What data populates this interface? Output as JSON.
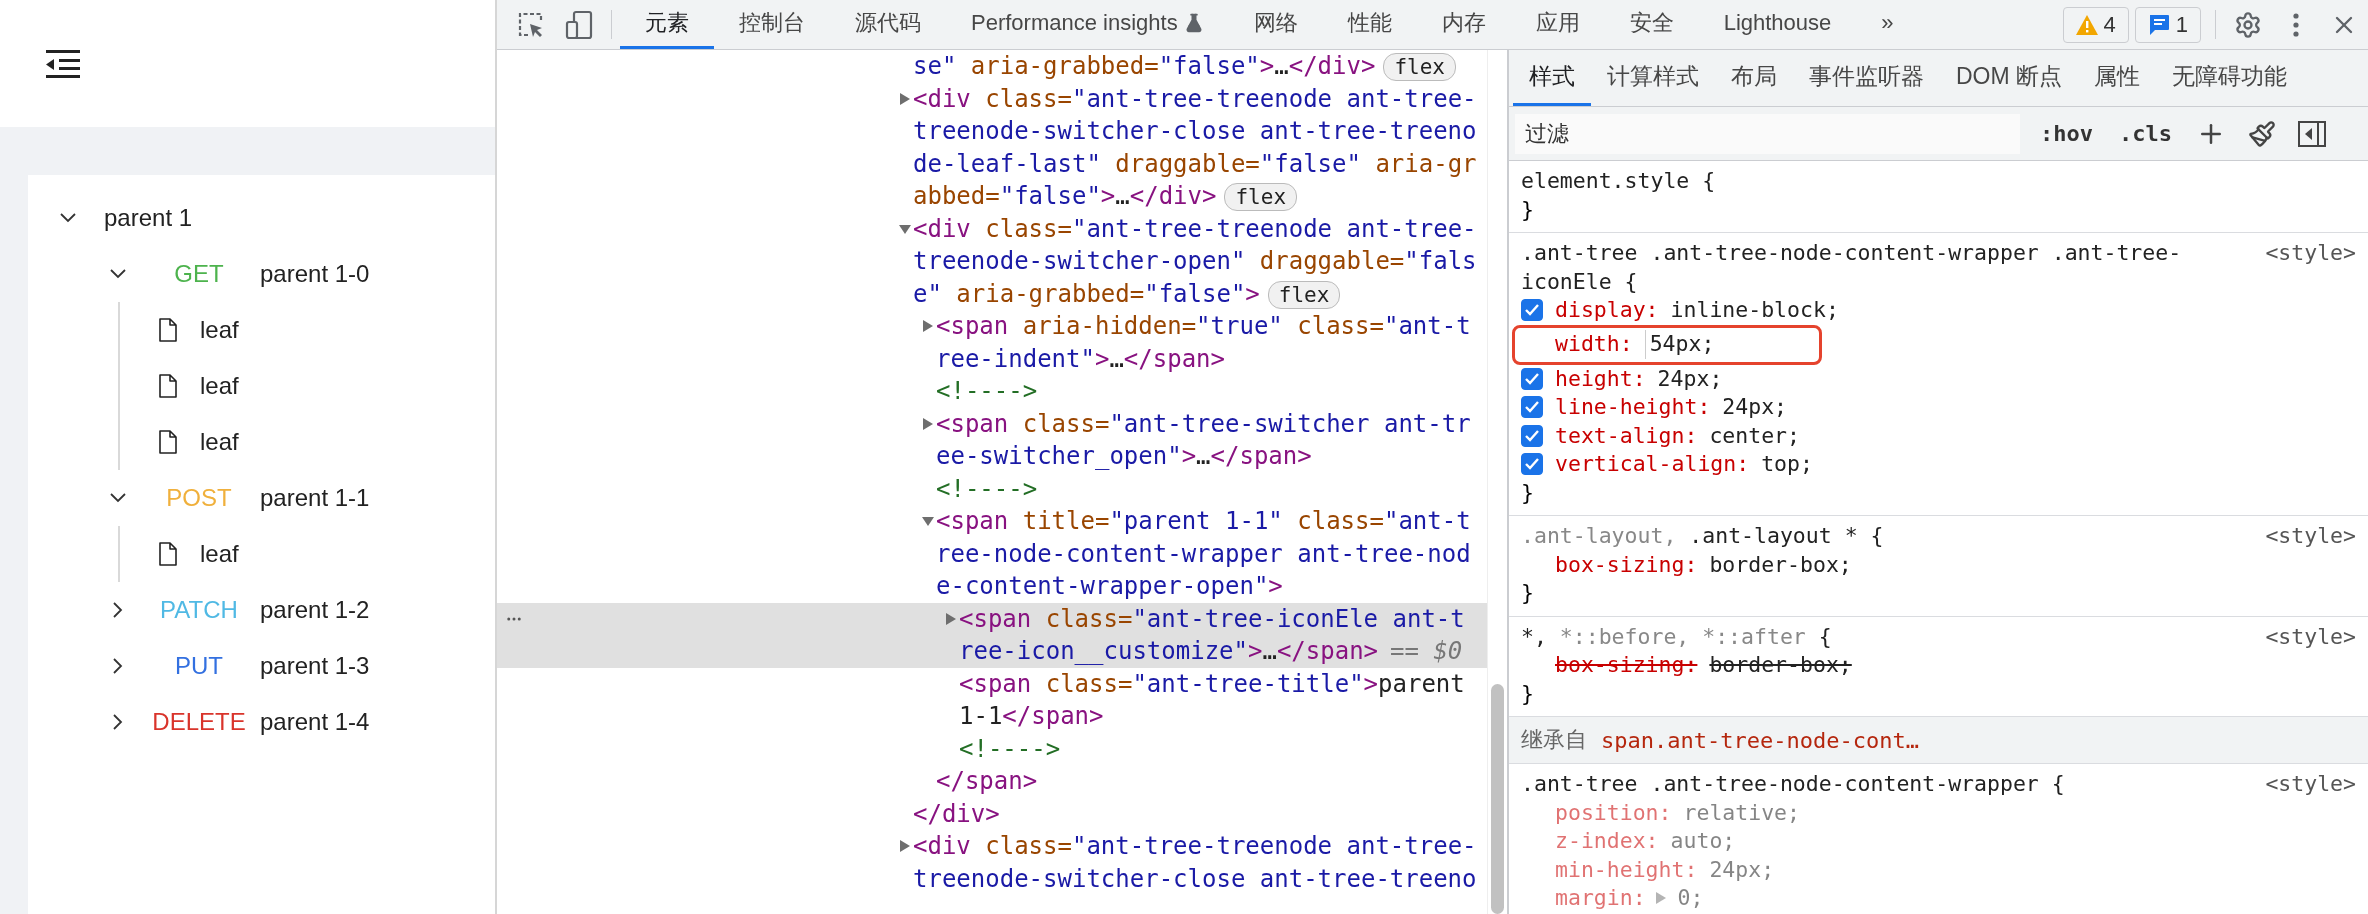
{
  "app": {
    "tree": [
      {
        "kind": "branch",
        "title": "parent 1",
        "expanded": true,
        "children": [
          {
            "kind": "branch",
            "method": "GET",
            "color": "#4db34d",
            "title": "parent 1-0",
            "expanded": true,
            "children": [
              {
                "kind": "leaf",
                "title": "leaf"
              },
              {
                "kind": "leaf",
                "title": "leaf"
              },
              {
                "kind": "leaf",
                "title": "leaf"
              }
            ]
          },
          {
            "kind": "branch",
            "method": "POST",
            "color": "#f0b03c",
            "title": "parent 1-1",
            "expanded": true,
            "children": [
              {
                "kind": "leaf",
                "title": "leaf"
              }
            ]
          },
          {
            "kind": "branch",
            "method": "PATCH",
            "color": "#50b9e4",
            "title": "parent 1-2",
            "expanded": false
          },
          {
            "kind": "branch",
            "method": "PUT",
            "color": "#3370e0",
            "title": "parent 1-3",
            "expanded": false
          },
          {
            "kind": "branch",
            "method": "DELETE",
            "color": "#d9342b",
            "title": "parent 1-4",
            "expanded": false
          }
        ]
      }
    ]
  },
  "devtools": {
    "toolbar": {
      "tabs": [
        {
          "label": "元素",
          "selected": true,
          "experimental": false
        },
        {
          "label": "控制台",
          "selected": false,
          "experimental": false
        },
        {
          "label": "源代码",
          "selected": false,
          "experimental": false
        },
        {
          "label": "Performance insights",
          "selected": false,
          "experimental": true
        },
        {
          "label": "网络",
          "selected": false,
          "experimental": false
        },
        {
          "label": "性能",
          "selected": false,
          "experimental": false
        },
        {
          "label": "内存",
          "selected": false,
          "experimental": false
        },
        {
          "label": "应用",
          "selected": false,
          "experimental": false
        },
        {
          "label": "安全",
          "selected": false,
          "experimental": false
        },
        {
          "label": "Lighthouse",
          "selected": false,
          "experimental": false
        }
      ],
      "overflow": "»",
      "warnings": "4",
      "messages": "1"
    },
    "dom": [
      {
        "kind": "fragment",
        "selected": false,
        "badge": "flex",
        "tokens": [
          {
            "kind": "value",
            "text": "se\""
          },
          {
            "kind": "attr",
            "text": " aria-grabbed="
          },
          {
            "kind": "value",
            "text": "\"false\""
          },
          {
            "kind": "tag",
            "text": ">"
          },
          {
            "kind": "text",
            "text": "…"
          },
          {
            "kind": "tag",
            "text": "</div>"
          }
        ]
      },
      {
        "kind": "element",
        "expanded": false,
        "selected": false,
        "badge": "flex",
        "tokens": [
          {
            "kind": "tag",
            "text": "<div"
          },
          {
            "kind": "attr",
            "text": " class="
          },
          {
            "kind": "value",
            "text": "\"ant-tree-treenode ant-tree-treenode-switcher-close ant-tree-treenode-leaf-last\""
          },
          {
            "kind": "attr",
            "text": " draggable="
          },
          {
            "kind": "value",
            "text": "\"false\""
          },
          {
            "kind": "attr",
            "text": " aria-grabbed="
          },
          {
            "kind": "value",
            "text": "\"false\""
          },
          {
            "kind": "tag",
            "text": ">"
          },
          {
            "kind": "text",
            "text": "…"
          },
          {
            "kind": "tag",
            "text": "</div>"
          }
        ]
      },
      {
        "kind": "element",
        "expanded": true,
        "selected": false,
        "badge": "flex",
        "tokens": [
          {
            "kind": "tag",
            "text": "<div"
          },
          {
            "kind": "attr",
            "text": " class="
          },
          {
            "kind": "value",
            "text": "\"ant-tree-treenode ant-tree-treenode-switcher-open\""
          },
          {
            "kind": "attr",
            "text": " draggable="
          },
          {
            "kind": "value",
            "text": "\"false\""
          },
          {
            "kind": "attr",
            "text": " aria-grabbed="
          },
          {
            "kind": "value",
            "text": "\"false\""
          },
          {
            "kind": "tag",
            "text": ">"
          }
        ],
        "closing": [
          {
            "kind": "tag",
            "text": "</div>"
          }
        ],
        "children": [
          {
            "kind": "element",
            "expanded": false,
            "selected": false,
            "tokens": [
              {
                "kind": "tag",
                "text": "<span"
              },
              {
                "kind": "attr",
                "text": " aria-hidden="
              },
              {
                "kind": "value",
                "text": "\"true\""
              },
              {
                "kind": "attr",
                "text": " class="
              },
              {
                "kind": "value",
                "text": "\"ant-tree-indent\""
              },
              {
                "kind": "tag",
                "text": ">"
              },
              {
                "kind": "text",
                "text": "…"
              },
              {
                "kind": "tag",
                "text": "</span>"
              }
            ]
          },
          {
            "kind": "comment",
            "selected": false,
            "tokens": [
              {
                "kind": "comment",
                "text": "<!---->"
              }
            ]
          },
          {
            "kind": "element",
            "expanded": false,
            "selected": false,
            "tokens": [
              {
                "kind": "tag",
                "text": "<span"
              },
              {
                "kind": "attr",
                "text": " class="
              },
              {
                "kind": "value",
                "text": "\"ant-tree-switcher ant-tree-switcher_open\""
              },
              {
                "kind": "tag",
                "text": ">"
              },
              {
                "kind": "text",
                "text": "…"
              },
              {
                "kind": "tag",
                "text": "</span>"
              }
            ]
          },
          {
            "kind": "comment",
            "selected": false,
            "tokens": [
              {
                "kind": "comment",
                "text": "<!---->"
              }
            ]
          },
          {
            "kind": "element",
            "expanded": true,
            "selected": false,
            "tokens": [
              {
                "kind": "tag",
                "text": "<span"
              },
              {
                "kind": "attr",
                "text": " title="
              },
              {
                "kind": "value",
                "text": "\"parent 1-1\""
              },
              {
                "kind": "attr",
                "text": " class="
              },
              {
                "kind": "value",
                "text": "\"ant-tree-node-content-wrapper ant-tree-node-content-wrapper-open\""
              },
              {
                "kind": "tag",
                "text": ">"
              }
            ],
            "closing": [
              {
                "kind": "tag",
                "text": "</span>"
              }
            ],
            "children": [
              {
                "kind": "element",
                "expanded": false,
                "selected": true,
                "suffix": "== $0",
                "tokens": [
                  {
                    "kind": "tag",
                    "text": "<span"
                  },
                  {
                    "kind": "attr",
                    "text": " class="
                  },
                  {
                    "kind": "value",
                    "text": "\"ant-tree-iconEle ant-tree-icon__customize\""
                  },
                  {
                    "kind": "tag",
                    "text": ">"
                  },
                  {
                    "kind": "text",
                    "text": "…"
                  },
                  {
                    "kind": "tag",
                    "text": "</span>"
                  }
                ]
              },
              {
                "kind": "leaf",
                "selected": false,
                "tokens": [
                  {
                    "kind": "tag",
                    "text": "<span"
                  },
                  {
                    "kind": "attr",
                    "text": " class="
                  },
                  {
                    "kind": "value",
                    "text": "\"ant-tree-title\""
                  },
                  {
                    "kind": "tag",
                    "text": ">"
                  },
                  {
                    "kind": "text",
                    "text": "parent 1-1"
                  },
                  {
                    "kind": "tag",
                    "text": "</span>"
                  }
                ]
              },
              {
                "kind": "comment",
                "selected": false,
                "tokens": [
                  {
                    "kind": "comment",
                    "text": "<!---->"
                  }
                ]
              }
            ]
          }
        ]
      },
      {
        "kind": "element",
        "expanded": false,
        "selected": false,
        "tokens": [
          {
            "kind": "tag",
            "text": "<div"
          },
          {
            "kind": "attr",
            "text": " class="
          },
          {
            "kind": "value",
            "text": "\"ant-tree-treenode ant-tree-treenode-switcher-close ant-tree-treeno"
          }
        ]
      }
    ],
    "styles": {
      "tabs": [
        {
          "label": "样式",
          "selected": true
        },
        {
          "label": "计算样式",
          "selected": false
        },
        {
          "label": "布局",
          "selected": false
        },
        {
          "label": "事件监听器",
          "selected": false
        },
        {
          "label": "DOM 断点",
          "selected": false
        },
        {
          "label": "属性",
          "selected": false
        },
        {
          "label": "无障碍功能",
          "selected": false
        }
      ],
      "filter_placeholder": "过滤",
      "hov": ":hov",
      "cls": ".cls",
      "rules": [
        {
          "kind": "rule",
          "selector": [
            {
              "text": "element.style {",
              "matched": true
            }
          ],
          "close": "}"
        },
        {
          "kind": "rule",
          "selector": [
            {
              "text": ".ant-tree .ant-tree-node-content-wrapper .ant-tree-iconEle {",
              "matched": true
            }
          ],
          "source": "<style>",
          "close": "}",
          "properties": [
            {
              "kind": "toggle",
              "checked": true,
              "name": "display:",
              "value": "inline-block;"
            },
            {
              "kind": "editing",
              "checked": false,
              "name": "width:",
              "value": "54px;"
            },
            {
              "kind": "toggle",
              "checked": true,
              "name": "height:",
              "value": "24px;"
            },
            {
              "kind": "toggle",
              "checked": true,
              "name": "line-height:",
              "value": "24px;"
            },
            {
              "kind": "toggle",
              "checked": true,
              "name": "text-align:",
              "value": "center;"
            },
            {
              "kind": "toggle",
              "checked": true,
              "name": "vertical-align:",
              "value": "top;"
            }
          ]
        },
        {
          "kind": "rule",
          "selector": [
            {
              "text": ".ant-layout,",
              "matched": false
            },
            {
              "text": " .ant-layout * {",
              "matched": true
            }
          ],
          "source": "<style>",
          "close": "}",
          "properties": [
            {
              "kind": "plain",
              "name": "box-sizing:",
              "value": "border-box;"
            }
          ]
        },
        {
          "kind": "rule",
          "selector": [
            {
              "text": "*,",
              "matched": true
            },
            {
              "text": " *::before, *::after",
              "matched": false
            },
            {
              "text": " {",
              "matched": true
            }
          ],
          "source": "<style>",
          "close": "}",
          "properties": [
            {
              "kind": "struck",
              "name": "box-sizing:",
              "value": "border-box;"
            }
          ]
        },
        {
          "kind": "inherited",
          "label": "继承自",
          "target": "span.ant-tree-node-cont…"
        },
        {
          "kind": "rule",
          "selector": [
            {
              "text": ".ant-tree .ant-tree-node-content-wrapper {",
              "matched": true
            }
          ],
          "source": "<style>",
          "properties": [
            {
              "kind": "dimmed",
              "name": "position:",
              "value": "relative;"
            },
            {
              "kind": "dimmed",
              "name": "z-index:",
              "value": "auto;"
            },
            {
              "kind": "dimmed",
              "name": "min-height:",
              "value": "24px;"
            },
            {
              "kind": "dimmed",
              "expandable": true,
              "name": "margin:",
              "value": "0;"
            }
          ]
        }
      ]
    }
  }
}
